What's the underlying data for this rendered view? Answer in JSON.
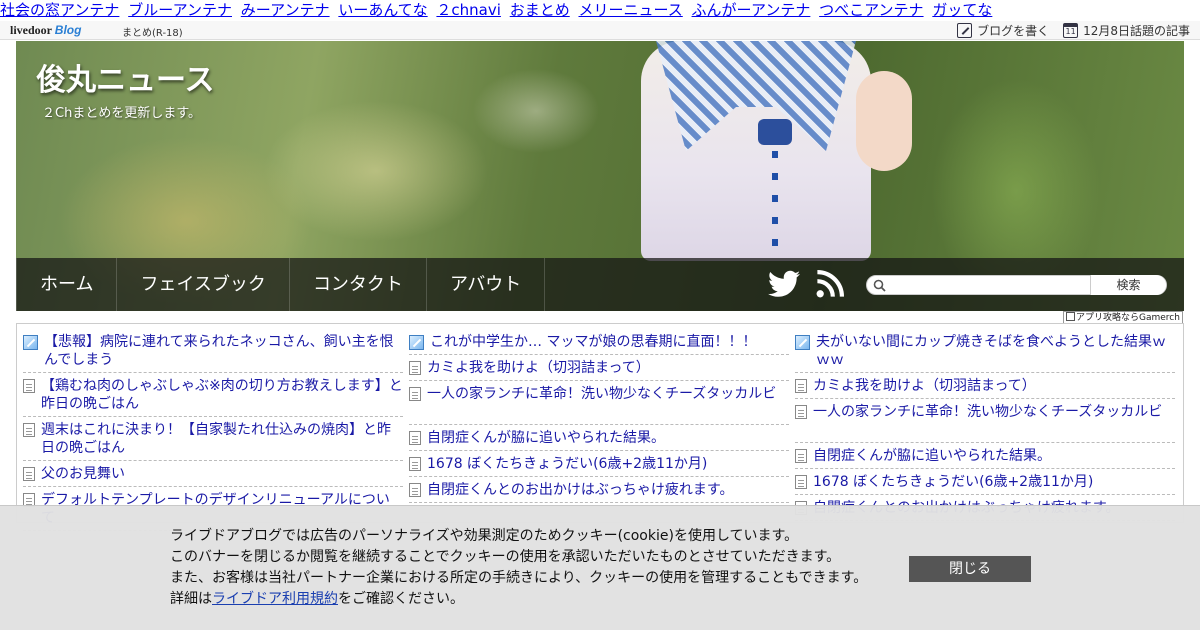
{
  "antenna_links": [
    "社会の窓アンテナ",
    "ブルーアンテナ",
    "みーアンテナ",
    "いーあんてな",
    "２chnavi",
    "おまとめ",
    "メリーニュース",
    "ふんがーアンテナ",
    "つべこアンテナ",
    "ガッてな"
  ],
  "ldbar": {
    "logo_main": "livedoor",
    "logo_blog": "Blog",
    "category": "まとめ(R-18)",
    "write_blog": "ブログを書く",
    "calendar_day": "11",
    "topic_link": "12月8日話題の記事"
  },
  "header": {
    "title": "俊丸ニュース",
    "description": "２Chまとめを更新します。"
  },
  "nav": {
    "items": [
      "ホーム",
      "フェイスブック",
      "コンタクト",
      "アバウト"
    ],
    "search_button": "検索",
    "search_placeholder": ""
  },
  "gamerch": "アプリ攻略ならGamerch",
  "rss": {
    "col1": [
      {
        "icon": "new",
        "title": "【悲報】病院に連れて来られたネッコさん、飼い主を恨んでしまう"
      },
      {
        "icon": "page",
        "title": "【鶏むね肉のしゃぶしゃぶ※肉の切り方お教えします】と昨日の晩ごはん"
      },
      {
        "icon": "page",
        "title": "週末はこれに決まり！【自家製たれ仕込みの焼肉】と昨日の晩ごはん"
      },
      {
        "icon": "page",
        "title": "父のお見舞い"
      },
      {
        "icon": "page",
        "title": "デフォルトテンプレートのデザインリニューアルについて"
      }
    ],
    "col2": [
      {
        "icon": "new",
        "title": "これが中学生か… マッマが娘の思春期に直面！！！"
      },
      {
        "icon": "page",
        "title": "カミよ我を助けよ（切羽詰まって）"
      },
      {
        "icon": "page",
        "title": "一人の家ランチに革命！洗い物少なくチーズタッカルビ"
      },
      {
        "icon": "page",
        "title": "自閉症くんが脇に追いやられた結果。"
      },
      {
        "icon": "page",
        "title": "1678 ぼくたちきょうだい(6歳+2歳11か月)"
      },
      {
        "icon": "page",
        "title": "自閉症くんとのお出かけはぶっちゃけ疲れます。"
      }
    ],
    "col3": [
      {
        "icon": "new",
        "title": "夫がいない間にカップ焼きそばを食べようとした結果ｗｗｗ"
      },
      {
        "icon": "page",
        "title": "カミよ我を助けよ（切羽詰まって）"
      },
      {
        "icon": "page",
        "title": "一人の家ランチに革命！洗い物少なくチーズタッカルビ"
      },
      {
        "icon": "page",
        "title": "自閉症くんが脇に追いやられた結果。"
      },
      {
        "icon": "page",
        "title": "1678 ぼくたちきょうだい(6歳+2歳11か月)"
      },
      {
        "icon": "page",
        "title": "自閉症くんとのお出かけはぶっちゃけ疲れます。"
      }
    ]
  },
  "cookie": {
    "line1": "ライブドアブログでは広告のパーソナライズや効果測定のためクッキー(cookie)を使用しています。",
    "line2": "このバナーを閉じるか閲覧を継続することでクッキーの使用を承認いただいたものとさせていただきます。",
    "line3": "また、お客様は当社パートナー企業における所定の手続きにより、クッキーの使用を管理することもできます。",
    "line4_prefix": "詳細は",
    "line4_link": "ライブドア利用規約",
    "line4_suffix": "をご確認ください。",
    "close_button": "閉じる"
  }
}
